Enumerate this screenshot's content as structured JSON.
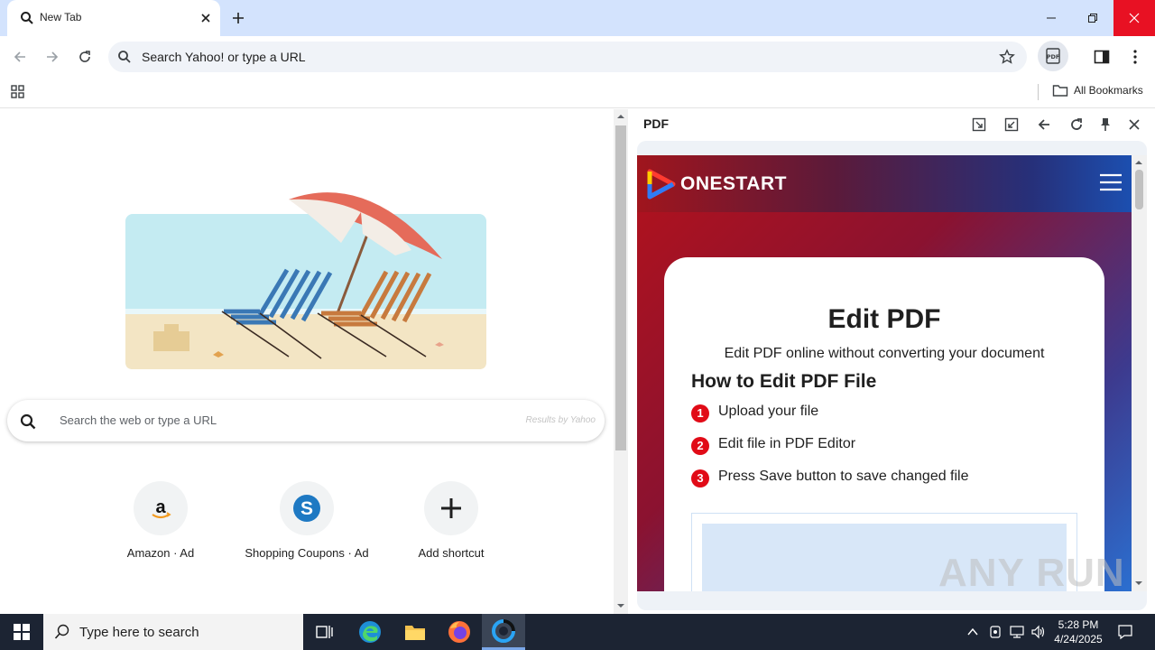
{
  "browser": {
    "tab_title": "New Tab",
    "address_placeholder": "Search Yahoo! or type a URL",
    "all_bookmarks_label": "All Bookmarks"
  },
  "new_tab_page": {
    "search_placeholder": "Search the web or type a URL",
    "results_by": "Results by Yahoo",
    "shortcuts": [
      {
        "label": "Amazon · Ad",
        "icon": "amazon-icon"
      },
      {
        "label": "Shopping Coupons · Ad",
        "icon": "shopping-coupons-icon"
      },
      {
        "label": "Add shortcut",
        "icon": "plus-icon"
      }
    ]
  },
  "side_panel": {
    "title": "PDF",
    "site": {
      "brand": "ONESTART",
      "heading": "Edit PDF",
      "subtitle": "Edit PDF online without converting your document",
      "howto_heading": "How to Edit PDF File",
      "steps": [
        {
          "num": "1",
          "text": "Upload your file"
        },
        {
          "num": "2",
          "text": "Edit file in PDF Editor"
        },
        {
          "num": "3",
          "text": "Press Save button to save changed file"
        }
      ]
    }
  },
  "watermark": "ANY RUN",
  "taskbar": {
    "search_placeholder": "Type here to search",
    "time": "5:28 PM",
    "date": "4/24/2025"
  },
  "colors": {
    "titlebar": "#d3e3fd",
    "close_red": "#e81123",
    "step_badge": "#e10b17",
    "taskbar": "#1c2433"
  }
}
